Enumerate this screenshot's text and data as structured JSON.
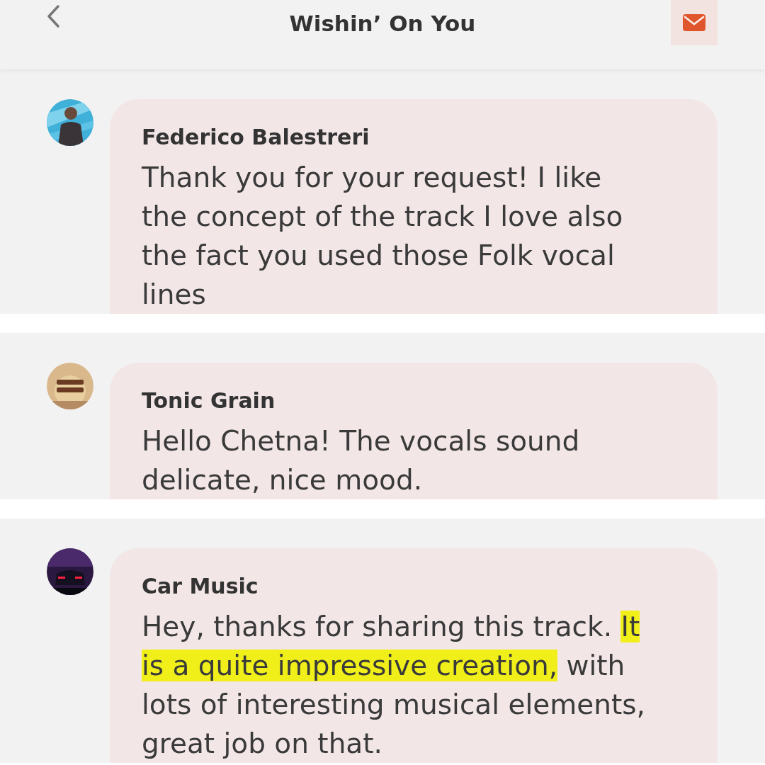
{
  "header": {
    "title": "Wishin’ On You"
  },
  "comments": [
    {
      "author": "Federico Balestreri",
      "kind": "person",
      "segments": [
        {
          "text": "Thank you for your request! I like the concept of the track I love also the fact you used those Folk vocal lines",
          "highlighted": false
        }
      ]
    },
    {
      "author": "Tonic Grain",
      "kind": "badge",
      "segments": [
        {
          "text": "Hello Chetna! The vocals sound delicate, nice mood.",
          "highlighted": false
        }
      ]
    },
    {
      "author": "Car Music",
      "kind": "car",
      "segments": [
        {
          "text": "Hey, thanks for sharing this track. ",
          "highlighted": false
        },
        {
          "text": "It is a quite impressive creation,",
          "highlighted": true
        },
        {
          "text": " with lots of interesting musical elements, great job on that.",
          "highlighted": false
        }
      ]
    }
  ]
}
